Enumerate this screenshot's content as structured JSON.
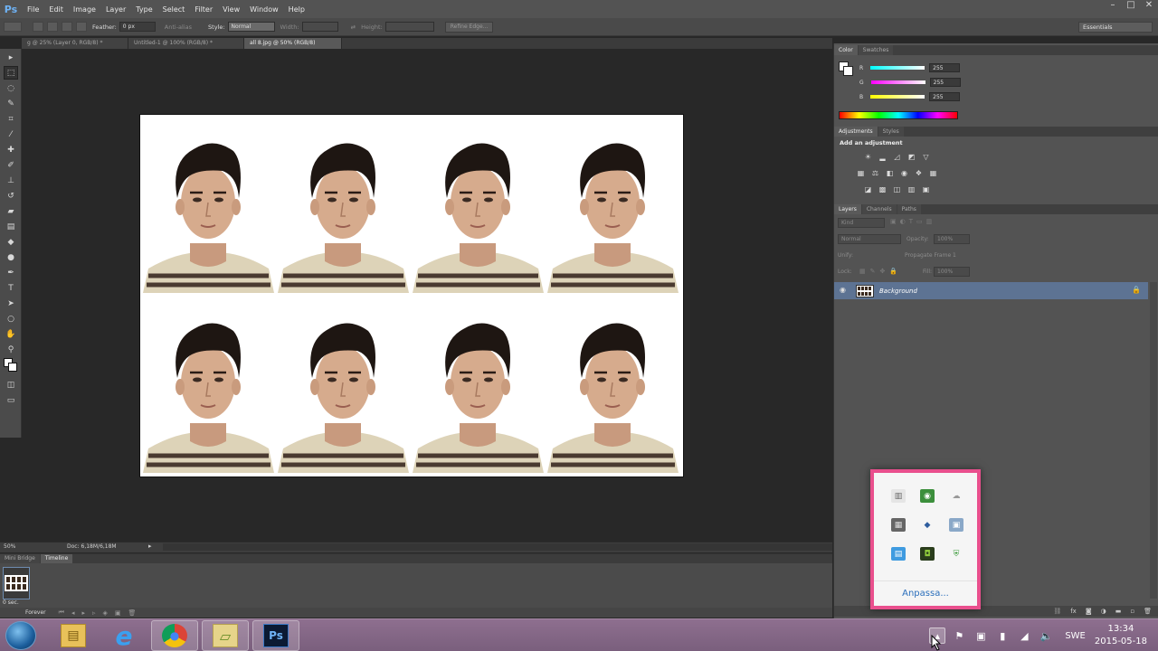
{
  "app": {
    "logo": "Ps"
  },
  "menu": [
    "File",
    "Edit",
    "Image",
    "Layer",
    "Type",
    "Select",
    "Filter",
    "View",
    "Window",
    "Help"
  ],
  "window_controls": [
    "–",
    "□",
    "✕"
  ],
  "options": {
    "feather_label": "Feather:",
    "feather_value": "0 px",
    "antialias_label": "Anti-alias",
    "style_label": "Style:",
    "style_value": "Normal",
    "width_label": "Width:",
    "height_label": "Height:",
    "refine_label": "Refine Edge...",
    "workspace": "Essentials"
  },
  "doc_tabs": [
    {
      "label": "g @ 25% (Layer 0, RGB/8) *",
      "active": false
    },
    {
      "label": "Untitled-1 @ 100% (RGB/8) *",
      "active": false
    },
    {
      "label": "all 8.jpg @ 50% (RGB/8)",
      "active": true
    }
  ],
  "tools": [
    "move-icon",
    "marquee-icon",
    "lasso-icon",
    "quick-select-icon",
    "crop-icon",
    "eyedropper-icon",
    "healing-icon",
    "brush-icon",
    "clone-stamp-icon",
    "history-brush-icon",
    "eraser-icon",
    "gradient-icon",
    "blur-icon",
    "dodge-icon",
    "pen-icon",
    "type-icon",
    "path-select-icon",
    "shape-icon",
    "hand-icon",
    "zoom-icon"
  ],
  "status": {
    "zoom": "50%",
    "doc": "Doc: 6,18M/6,18M"
  },
  "timeline": {
    "tabs": [
      "Mini Bridge",
      "Timeline"
    ],
    "frame_delay": "0 sec.",
    "loop": "Forever"
  },
  "color_panel": {
    "tabs": [
      "Color",
      "Swatches"
    ],
    "channels": [
      {
        "label": "R",
        "value": "255",
        "color": "#ff4040"
      },
      {
        "label": "G",
        "value": "255",
        "color": "#ff40ff"
      },
      {
        "label": "B",
        "value": "255",
        "color": "#ffff40"
      }
    ]
  },
  "adjustments": {
    "tabs": [
      "Adjustments",
      "Styles"
    ],
    "title": "Add an adjustment"
  },
  "layers": {
    "tabs": [
      "Layers",
      "Channels",
      "Paths"
    ],
    "kind_label": "Kind",
    "blend_mode": "Normal",
    "opacity_label": "Opacity:",
    "opacity_value": "100%",
    "unify_label": "Unify:",
    "propagate_label": "Propagate Frame 1",
    "lock_label": "Lock:",
    "fill_label": "Fill:",
    "fill_value": "100%",
    "layer_name": "Background"
  },
  "tray_popup": {
    "customize": "Anpassa..."
  },
  "taskbar": {
    "lang": "SWE",
    "time": "13:34",
    "date": "2015-05-18",
    "apps": [
      {
        "name": "explorer",
        "glyph": "▤"
      },
      {
        "name": "internet-explorer",
        "glyph": "e"
      },
      {
        "name": "chrome",
        "glyph": "●"
      },
      {
        "name": "folder",
        "glyph": "▱"
      },
      {
        "name": "photoshop",
        "glyph": "Ps"
      }
    ]
  }
}
